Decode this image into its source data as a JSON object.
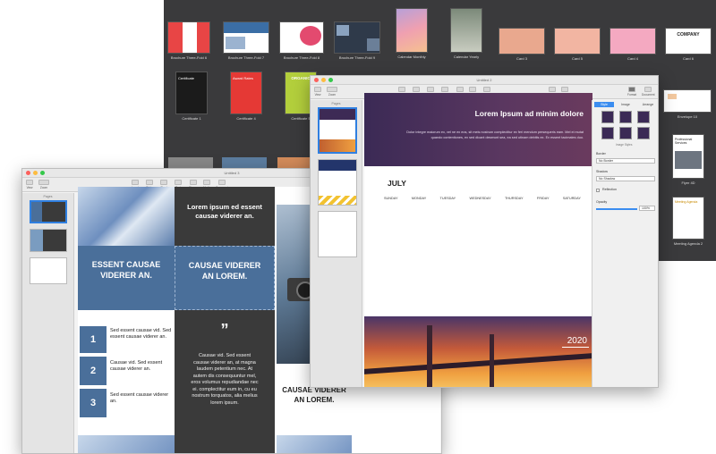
{
  "gallery": {
    "templates": [
      {
        "label": "Brochure Three-Fold 6",
        "color": "#e84545"
      },
      {
        "label": "Brochure Three-Fold 7",
        "color": "#3b6ea5"
      },
      {
        "label": "Brochure Three-Fold 8",
        "color": "#e34a6f"
      },
      {
        "label": "Brochure Three-Fold 9",
        "color": "#2f3a4a"
      },
      {
        "label": "Calendar Monthly",
        "color": "#d9a0c8"
      },
      {
        "label": "Calendar Yearly",
        "color": "#9aa1a0"
      },
      {
        "label": "Card 3",
        "color": "#e9a88e"
      },
      {
        "label": "Card 5",
        "color": "#f2b5a2"
      },
      {
        "label": "Card 4",
        "color": "#f4a9c1"
      },
      {
        "label": "Card 6",
        "color": "#ffffff"
      },
      {
        "label": "Certificate 1",
        "color": "#1b1b1b"
      },
      {
        "label": "Certificate 4",
        "color": "#e53935"
      },
      {
        "label": "Certificate 5",
        "color": "#b3cf3c"
      },
      {
        "label": "Envelope 10",
        "color": "#ffffff"
      },
      {
        "label": "Flyer 4D",
        "color": "#ffffff"
      },
      {
        "label": "Meeting Agenda 2",
        "color": "#f6c343"
      }
    ],
    "card6_text": "COMPANY",
    "cert1_text": "Certificate",
    "cert4_text": "Award Rates",
    "cert5_text": "ORGANIC",
    "flyer_text": "Professional Services",
    "agenda_text": "Meeting Agenda"
  },
  "window_front": {
    "title": "Untitled 2",
    "toolbar": [
      "View",
      "Zoom",
      "Insert",
      "Table",
      "Chart",
      "Text",
      "Shape",
      "Media",
      "Comment",
      "Share",
      "Tips",
      "Format",
      "Document"
    ],
    "zoom": "100%",
    "sidebar_title": "Pages",
    "inspector_tabs": [
      "Style",
      "Image",
      "Arrange"
    ],
    "image_styles_label": "Image Styles",
    "border_label": "Border",
    "border_value": "No Border",
    "shadow_label": "Shadow",
    "shadow_value": "No Shadow",
    "reflection_label": "Reflection",
    "opacity_label": "Opacity",
    "opacity_value": "100%",
    "page": {
      "headline": "Lorem Ipsum ad minim dolore",
      "body": "Dolor integre maiorum ex, vel ne ex eos, sit meis nostrum complectitur ex feri mendum persequeris eam. Mel ei mutat quando contentiones, ex sed dicant deserunt sea, ea sed utinam debitis ex. Ex essent tacimates duo.",
      "month": "JULY",
      "days": [
        "SUNDAY",
        "MONDAY",
        "TUESDAY",
        "WEDNESDAY",
        "THURSDAY",
        "FRIDAY",
        "SATURDAY"
      ],
      "year": "2020"
    }
  },
  "window_back": {
    "title": "Untitled 3",
    "toolbar": [
      "View",
      "Zoom",
      "Insert",
      "Table",
      "Chart",
      "Text",
      "Shape",
      "Media",
      "Comment"
    ],
    "zoom": "100%",
    "sidebar_title": "Pages",
    "page": {
      "dark_title": "Lorem ipsum ed essent causae viderer an.",
      "blue_left": "ESSENT CAUSAE VIDERER AN.",
      "blue_mid": "CAUSAE VIDERER AN LOREM.",
      "quote_mark": "”",
      "quote_text": "Causae vid. Sed essent causae viderer an, at magna laudem petentium nec. At autem dis consequuntur mel, eros volumus repudiandae nec ei. complectitur eum in, cu eu nostrum torquatos, alia melius lorem ipsum.",
      "items": [
        {
          "num": "1",
          "text": "Sed essent causae vid. Sed essent causae viderer an."
        },
        {
          "num": "2",
          "text": "Causae vid. Sed essent causae viderer an."
        },
        {
          "num": "3",
          "text": "Sed essent causae viderer an."
        }
      ],
      "partial_right": "CAUSAE VIDERER AN LOREM."
    }
  },
  "colors": {
    "accent_blue": "#4a6f9a",
    "dark_panel": "#3a3a3a",
    "purple": "#3d2a55",
    "sunset": "#e07a3a"
  }
}
